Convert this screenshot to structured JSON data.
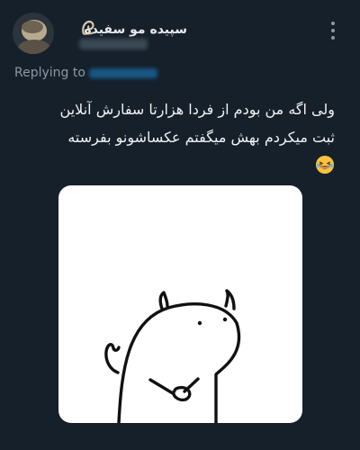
{
  "author": {
    "display_name": "سپیده مو سفیده"
  },
  "icons": {
    "avatar": "avatar",
    "name_emoji": "spiral-shell-icon",
    "more": "more-vertical-icon",
    "text_emoji": "grinning-squinting-face-emoji"
  },
  "reply": {
    "replying_to": "Replying to"
  },
  "tweet": {
    "lines": [
      "ولی اگه من بودم از فردا هزارتا سفارش آنلاین",
      "ثبت میکردم بهش میگفتم عکساشونو بفرسته"
    ]
  },
  "colors": {
    "background": "#15202b",
    "text": "#e7e9ea",
    "secondary": "#8b98a5",
    "accent": "#1d9bf0"
  }
}
